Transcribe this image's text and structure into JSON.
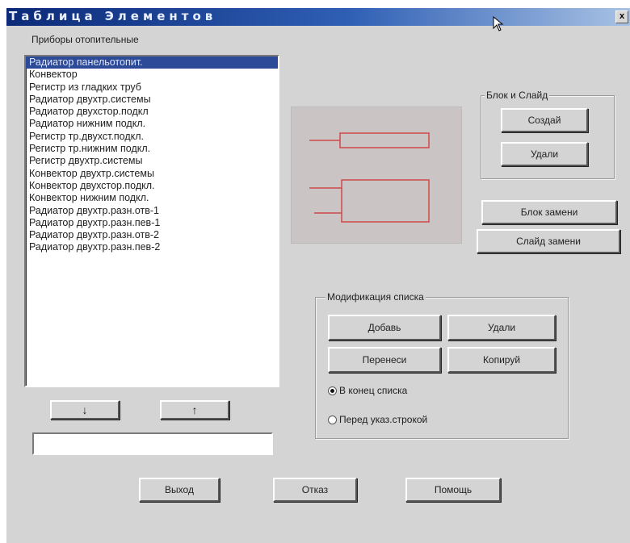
{
  "window": {
    "title": "Таблица Элементов",
    "close": "x"
  },
  "list": {
    "label": "Приборы отопительные",
    "items": [
      "Радиатор панельотопит.",
      "Конвектор",
      "Регистр из гладких труб",
      "Радиатор двухтр.системы",
      "Радиатор двухстор.подкл",
      "Радиатор нижним подкл.",
      "Регистр тр.двухст.подкл.",
      "Регистр тр.нижним подкл.",
      "Регистр двухтр.системы",
      "Конвектор двухтр.системы",
      "Конвектор двухстор.подкл.",
      "Конвектор нижним подкл.",
      "Радиатор двухтр.разн.отв-1",
      "Радиатор двухтр.разн.пев-1",
      "Радиатор двухтр.разн.отв-2",
      "Радиатор двухтр.разн.пев-2"
    ],
    "selected_index": 0,
    "down_arrow": "↓",
    "up_arrow": "↑",
    "input_value": ""
  },
  "block_slide": {
    "label": "Блок и Слайд",
    "create": "Создай",
    "delete": "Удали"
  },
  "replace": {
    "block": "Блок замени",
    "slide": "Слайд замени"
  },
  "modify": {
    "label": "Модификация списка",
    "add": "Добавь",
    "delete": "Удали",
    "move": "Перенеси",
    "copy": "Копируй",
    "radio_end": "В конец списка",
    "radio_before": "Перед указ.строкой",
    "selected": "end"
  },
  "footer": {
    "exit": "Выход",
    "cancel": "Отказ",
    "help": "Помощь"
  },
  "colors": {
    "preview_line": "#d04848",
    "selection": "#2c4a98"
  }
}
